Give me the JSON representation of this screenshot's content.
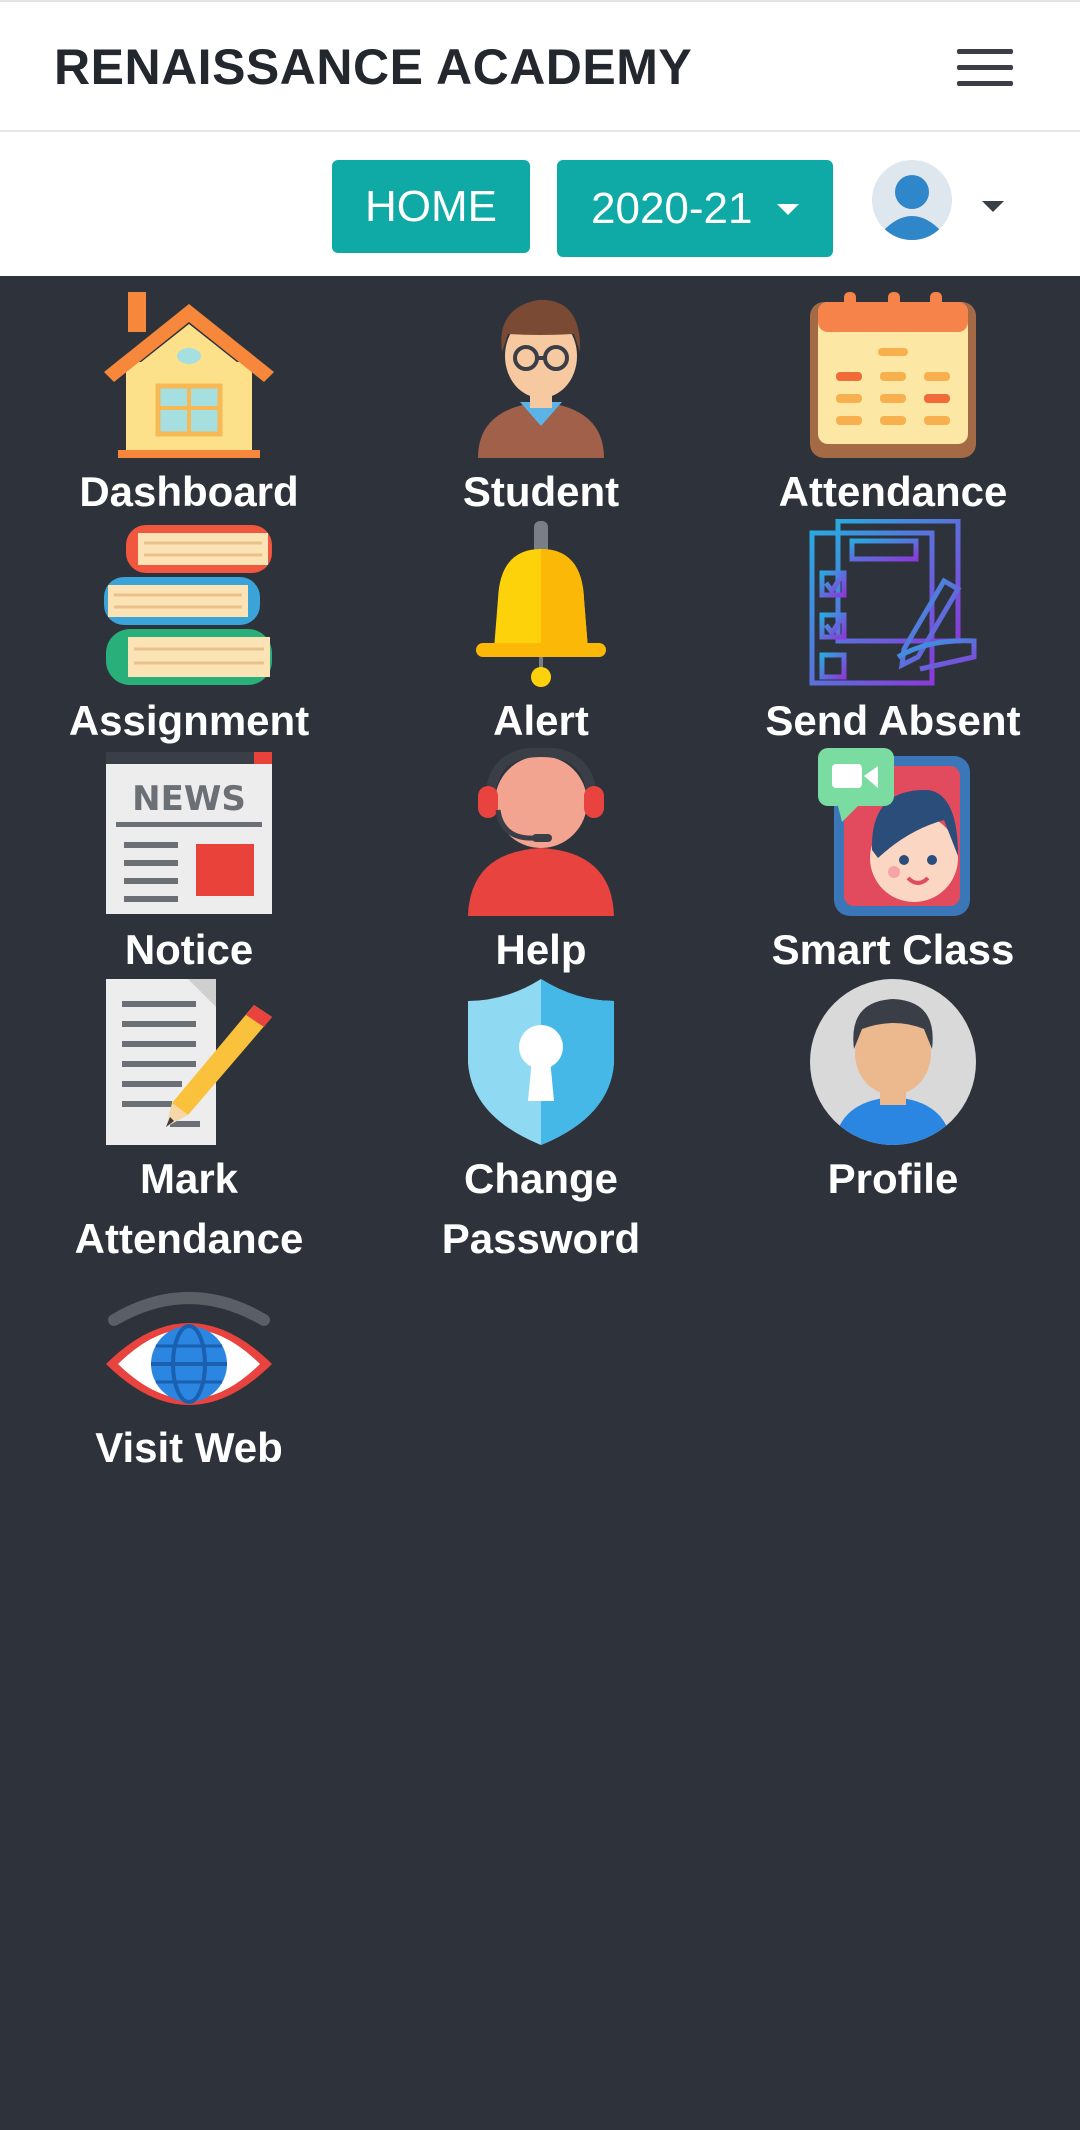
{
  "header": {
    "title": "RENAISSANCE ACADEMY",
    "menu_icon": "hamburger-menu-icon"
  },
  "nav": {
    "home_label": "HOME",
    "year_label": "2020-21",
    "avatar_icon": "user-avatar-icon",
    "accent_color": "#10aaa6"
  },
  "menu": {
    "background_color": "#2e333b",
    "items": [
      {
        "label": "Dashboard",
        "icon": "house-icon"
      },
      {
        "label": "Student",
        "icon": "student-icon"
      },
      {
        "label": "Attendance",
        "icon": "calendar-icon"
      },
      {
        "label": "Assignment",
        "icon": "books-icon"
      },
      {
        "label": "Alert",
        "icon": "bell-icon"
      },
      {
        "label": "Send Absent",
        "icon": "checklist-icon"
      },
      {
        "label": "Notice",
        "icon": "newspaper-icon"
      },
      {
        "label": "Help",
        "icon": "support-agent-icon"
      },
      {
        "label": "Smart Class",
        "icon": "video-call-icon"
      },
      {
        "label": "Mark",
        "label2": "Attendance",
        "icon": "document-pencil-icon"
      },
      {
        "label": "Change",
        "label2": "Password",
        "icon": "shield-lock-icon"
      },
      {
        "label": "Profile",
        "icon": "profile-avatar-icon"
      },
      {
        "label": "Visit Web",
        "icon": "eye-globe-icon"
      }
    ]
  }
}
